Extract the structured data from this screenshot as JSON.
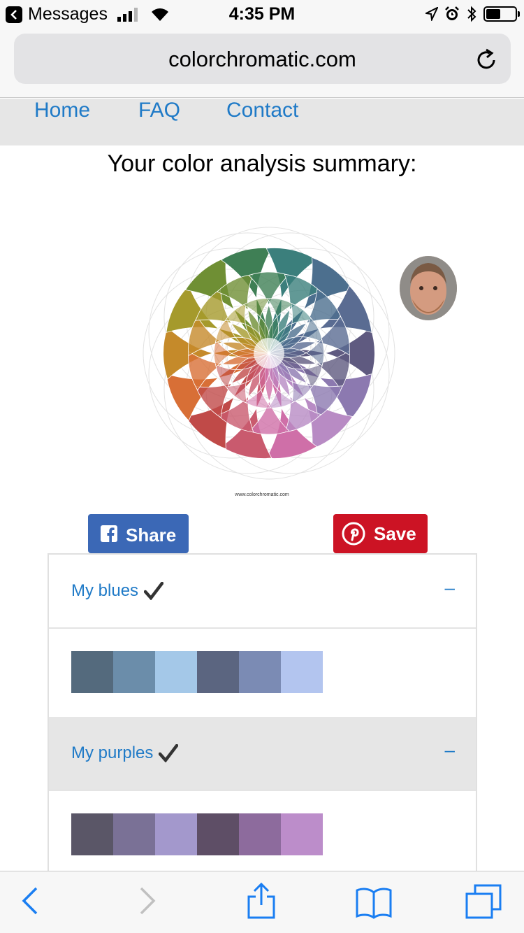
{
  "status_bar": {
    "back_app": "Messages",
    "time": "4:35 PM",
    "battery_level": 0.5
  },
  "browser": {
    "url": "colorchromatic.com"
  },
  "site_nav": {
    "links": [
      "Home",
      "FAQ",
      "Contact"
    ]
  },
  "summary": {
    "title": "Your color analysis summary:",
    "watermark": "www.colorchromatic.com"
  },
  "share": {
    "facebook_label": "Share",
    "pinterest_label": "Save"
  },
  "accordion": [
    {
      "title": "My blues",
      "checked": true,
      "toggle": "–",
      "colors": [
        "#546a7d",
        "#6b8daa",
        "#a4c8e8",
        "#5b6580",
        "#7b8bb4",
        "#b3c5ef"
      ]
    },
    {
      "title": "My purples",
      "checked": true,
      "toggle": "–",
      "colors": [
        "#5a5667",
        "#7a7196",
        "#a398cc",
        "#5e4e66",
        "#8d6b9d",
        "#bc8dca"
      ]
    }
  ],
  "colors": {
    "link": "#1f7ac7",
    "facebook": "#3b68b6",
    "pinterest": "#cc1324",
    "ios_blue": "#1a7ef2"
  }
}
